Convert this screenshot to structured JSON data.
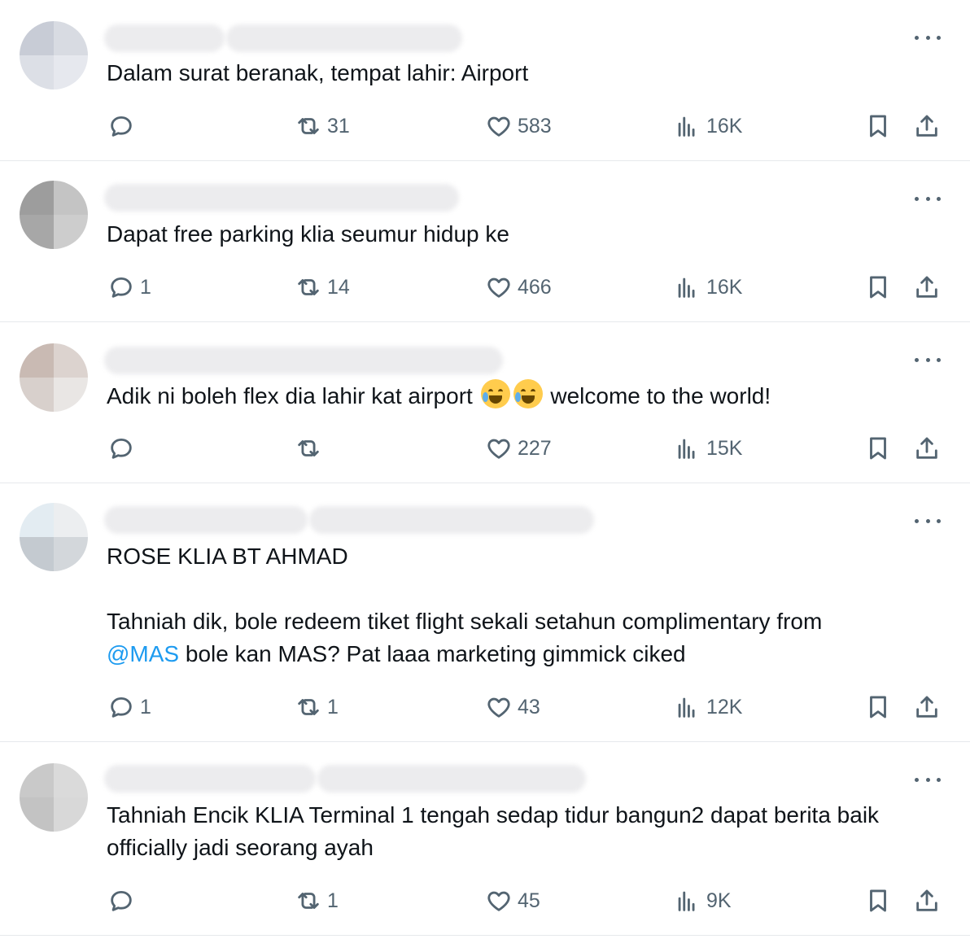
{
  "replies": [
    {
      "text": "Dalam surat beranak, tempat lahir: Airport",
      "reply_count": "",
      "retweet_count": "31",
      "like_count": "583",
      "view_count": "16K"
    },
    {
      "text": "Dapat free parking klia seumur hidup ke",
      "reply_count": "1",
      "retweet_count": "14",
      "like_count": "466",
      "view_count": "16K"
    },
    {
      "text_before": "Adik ni boleh flex dia lahir kat airport ",
      "emoji_1": "loudly-crying-face",
      "emoji_2": "face-with-tears-of-joy",
      "text_after": " welcome to the world!",
      "reply_count": "",
      "retweet_count": "",
      "like_count": "227",
      "view_count": "15K"
    },
    {
      "text_line1": "ROSE KLIA BT AHMAD",
      "text_line2": "Tahniah dik, bole redeem tiket flight sekali setahun complimentary from",
      "mention": "@MAS",
      "text_line3_rest": " bole kan MAS? Pat laaa marketing gimmick ciked",
      "reply_count": "1",
      "retweet_count": "1",
      "like_count": "43",
      "view_count": "12K"
    },
    {
      "text": "Tahniah Encik KLIA Terminal 1 tengah sedap tidur bangun2 dapat berita baik officially jadi seorang ayah",
      "reply_count": "",
      "retweet_count": "1",
      "like_count": "45",
      "view_count": "9K"
    }
  ],
  "icons": {
    "reply": "reply-bubble-icon",
    "retweet": "retweet-icon",
    "like": "heart-icon",
    "views": "bar-chart-icon",
    "bookmark": "bookmark-icon",
    "share": "share-icon",
    "more": "more-dots-icon"
  },
  "colors": {
    "text": "#0f1419",
    "secondary": "#536471",
    "mention": "#1d9bf0",
    "divider": "#e6e9ec"
  }
}
